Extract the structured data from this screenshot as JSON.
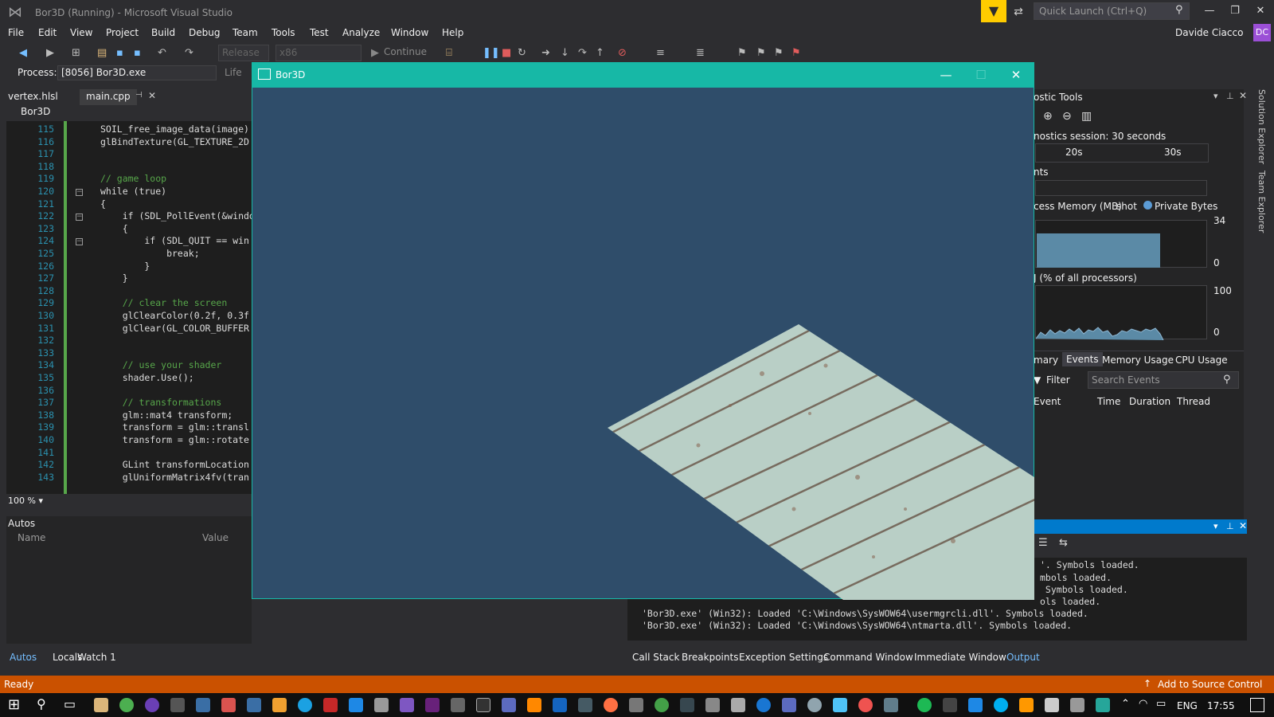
{
  "window": {
    "title": "Bor3D (Running) - Microsoft Visual Studio",
    "quick_launch_placeholder": "Quick Launch (Ctrl+Q)",
    "user_name": "Davide Ciacco",
    "user_initials": "DC"
  },
  "menu": [
    "File",
    "Edit",
    "View",
    "Project",
    "Build",
    "Debug",
    "Team",
    "Tools",
    "Test",
    "Analyze",
    "Window",
    "Help"
  ],
  "toolbar": {
    "config": "Release",
    "platform": "x86",
    "continue_label": "Continue",
    "lifecycle_label": "Life"
  },
  "process": {
    "label": "Process:",
    "value": "[8056] Bor3D.exe"
  },
  "editor": {
    "tabs": [
      "vertex.hlsl",
      "main.cpp"
    ],
    "nav_scope": "Bor3D",
    "zoom": "100 %",
    "lines": [
      {
        "n": "115",
        "code": "SOIL_free_image_data(image)"
      },
      {
        "n": "116",
        "code": "glBindTexture(GL_TEXTURE_2D"
      },
      {
        "n": "117",
        "code": ""
      },
      {
        "n": "118",
        "code": ""
      },
      {
        "n": "119",
        "code": "// game loop"
      },
      {
        "n": "120",
        "code": "while (true)"
      },
      {
        "n": "121",
        "code": "{"
      },
      {
        "n": "122",
        "code": "    if (SDL_PollEvent(&windo"
      },
      {
        "n": "123",
        "code": "    {"
      },
      {
        "n": "124",
        "code": "        if (SDL_QUIT == win"
      },
      {
        "n": "125",
        "code": "            break;"
      },
      {
        "n": "126",
        "code": "        }"
      },
      {
        "n": "127",
        "code": "    }"
      },
      {
        "n": "128",
        "code": ""
      },
      {
        "n": "129",
        "code": "    // clear the screen"
      },
      {
        "n": "130",
        "code": "    glClearColor(0.2f, 0.3f"
      },
      {
        "n": "131",
        "code": "    glClear(GL_COLOR_BUFFER"
      },
      {
        "n": "132",
        "code": ""
      },
      {
        "n": "133",
        "code": ""
      },
      {
        "n": "134",
        "code": "    // use your shader"
      },
      {
        "n": "135",
        "code": "    shader.Use();"
      },
      {
        "n": "136",
        "code": ""
      },
      {
        "n": "137",
        "code": "    // transformations"
      },
      {
        "n": "138",
        "code": "    glm::mat4 transform;"
      },
      {
        "n": "139",
        "code": "    transform = glm::transl"
      },
      {
        "n": "140",
        "code": "    transform = glm::rotate"
      },
      {
        "n": "141",
        "code": ""
      },
      {
        "n": "142",
        "code": "    GLint transformLocation"
      },
      {
        "n": "143",
        "code": "    glUniformMatrix4fv(tran"
      }
    ]
  },
  "autos": {
    "title": "Autos",
    "col_name": "Name",
    "col_value": "Value",
    "tabs": [
      "Autos",
      "Locals",
      "Watch 1"
    ]
  },
  "game_window": {
    "title": "Bor3D"
  },
  "diagnostics": {
    "title": "ostic Tools",
    "session": "nostics session: 30 seconds",
    "tick_20": "20s",
    "tick_30": "30s",
    "events": "nts",
    "memory_title": "cess Memory (MB)",
    "snapshot": "shot",
    "private_bytes": "Private Bytes",
    "mem_max": "34",
    "mem_min": "0",
    "mem_level": 0.72,
    "cpu_title": "J (% of all processors)",
    "cpu_max": "100",
    "cpu_min": "0",
    "tabs": [
      "mary",
      "Events",
      "Memory Usage",
      "CPU Usage"
    ],
    "filter": "Filter",
    "search_placeholder": "Search Events",
    "columns": [
      "Event",
      "Time",
      "Duration",
      "Thread"
    ]
  },
  "output": {
    "lines": [
      "'. Symbols loaded.",
      "mbols loaded.",
      " Symbols loaded.",
      "ols loaded.",
      "'Bor3D.exe' (Win32): Loaded 'C:\\Windows\\SysWOW64\\usermgrcli.dll'. Symbols loaded.",
      "'Bor3D.exe' (Win32): Loaded 'C:\\Windows\\SysWOW64\\ntmarta.dll'. Symbols loaded."
    ],
    "tabs": [
      "Call Stack",
      "Breakpoints",
      "Exception Settings",
      "Command Window",
      "Immediate Window",
      "Output"
    ]
  },
  "side_tabs": [
    "Solution Explorer",
    "Team Explorer"
  ],
  "status": {
    "ready": "Ready",
    "source_control": "Add to Source Control"
  },
  "taskbar": {
    "lang": "ENG",
    "time": "17:55"
  },
  "colors": {
    "accent": "#007acc",
    "status": "#ca5100",
    "game_bg": "#2f4d6a",
    "game_titlebar": "#17b8a6"
  }
}
